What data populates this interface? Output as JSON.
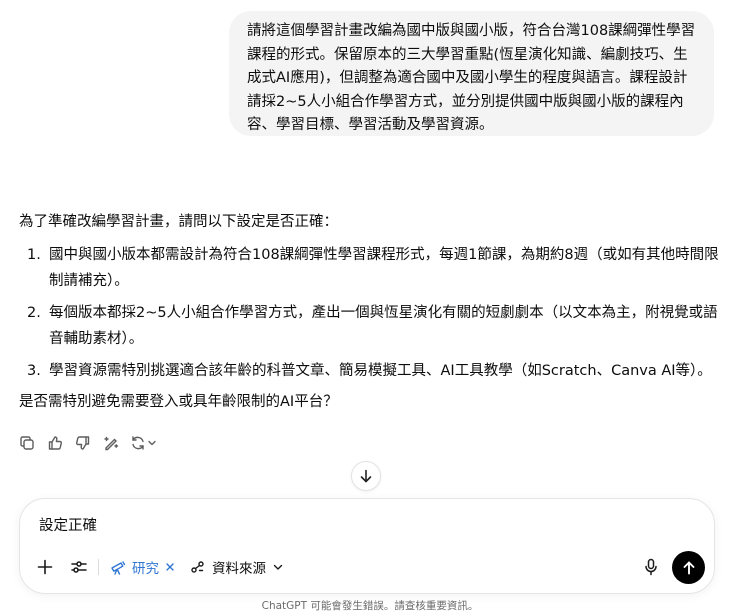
{
  "user_message": {
    "lines": [
      "請將這個學習計畫改編為國中版與國小版，符合台灣108課綱彈性學習",
      "課程的形式。保留原本的三大學習重點(恆星演化知識、編劇技巧、生",
      "成式AI應用)，但調整為適合國中及國小學生的程度與語言。課程設計",
      "請採2~5人小組合作學習方式，並分別提供國中版與國小版的課程內",
      "容、學習目標、學習活動及學習資源。"
    ]
  },
  "assistant_message": {
    "intro": "為了準確改編學習計畫，請問以下設定是否正確：",
    "items": [
      {
        "num": "1.",
        "lines": [
          "國中與國小版本都需設計為符合108課綱彈性學習課程形式，每週1節課，為期約8週（或如有其他時間限",
          "制請補充）。"
        ]
      },
      {
        "num": "2.",
        "lines": [
          "每個版本都採2~5人小組合作學習方式，產出一個與恆星演化有關的短劇劇本（以文本為主，附視覺或語",
          "音輔助素材）。"
        ]
      },
      {
        "num": "3.",
        "lines": [
          "學習資源需特別挑選適合該年齡的科普文章、簡易模擬工具、AI工具教學（如Scratch、Canva AI等）。"
        ]
      }
    ],
    "question": "是否需特別避免需要登入或具年齡限制的AI平台？"
  },
  "message_actions": {
    "icons": [
      "copy-icon",
      "thumbs-up-icon",
      "thumbs-down-icon",
      "edit-icon",
      "regenerate-icon"
    ]
  },
  "composer": {
    "input_value": "設定正確",
    "research_label": "研究",
    "sources_label": "資料來源"
  },
  "footer": {
    "disclaimer": "ChatGPT 可能會發生錯誤。請查核重要資訊。"
  },
  "colors": {
    "accent_blue": "#2f76d2",
    "bubble_bg": "#f4f4f4",
    "send_button": "#000000"
  }
}
